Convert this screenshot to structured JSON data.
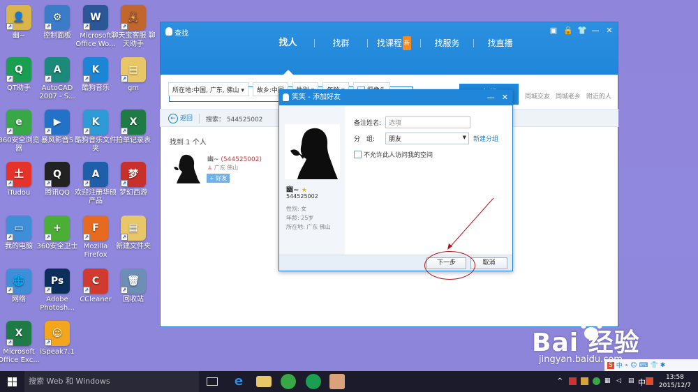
{
  "desktop": {
    "icons": [
      {
        "label": "幽~",
        "color": "#d9b54a",
        "glyph": "👤"
      },
      {
        "label": "控制面板",
        "color": "#3a7cc6",
        "glyph": "⚙"
      },
      {
        "label": "Microsoft Office Wo...",
        "color": "#2b5797",
        "glyph": "W"
      },
      {
        "label": "聊天宝客服 聊天助手",
        "color": "#c2662d",
        "glyph": "🧸"
      },
      {
        "label": "QT助手",
        "color": "#1a9e52",
        "glyph": "Q"
      },
      {
        "label": "AutoCAD 2007 - S...",
        "color": "#1b8a7a",
        "glyph": "A"
      },
      {
        "label": "酷狗音乐",
        "color": "#1b86d6",
        "glyph": "K"
      },
      {
        "label": "gm",
        "color": "#e8c768",
        "glyph": "▤"
      },
      {
        "label": "360安全浏览器",
        "color": "#37a845",
        "glyph": "e"
      },
      {
        "label": "暴风影音5",
        "color": "#2273c8",
        "glyph": "▶"
      },
      {
        "label": "酷狗音乐文件夹",
        "color": "#2e9ad6",
        "glyph": "K"
      },
      {
        "label": "拍单记录表",
        "color": "#1e7b45",
        "glyph": "X"
      },
      {
        "label": "iTudou",
        "color": "#e6332a",
        "glyph": "土"
      },
      {
        "label": "腾讯QQ",
        "color": "#222",
        "glyph": "Q"
      },
      {
        "label": "欢迎注册华硕产品",
        "color": "#1f5ea8",
        "glyph": "A"
      },
      {
        "label": "梦幻西游",
        "color": "#c9302c",
        "glyph": "梦"
      },
      {
        "label": "我的电脑",
        "color": "#3f8ed8",
        "glyph": "▭"
      },
      {
        "label": "360安全卫士",
        "color": "#4caf35",
        "glyph": "+"
      },
      {
        "label": "Mozilla Firefox",
        "color": "#e66a1f",
        "glyph": "F"
      },
      {
        "label": "新建文件夹",
        "color": "#e8c768",
        "glyph": "▤"
      },
      {
        "label": "网络",
        "color": "#3f8ed8",
        "glyph": "🌐"
      },
      {
        "label": "Adobe Photosh...",
        "color": "#0b2e5a",
        "glyph": "Ps"
      },
      {
        "label": "CCleaner",
        "color": "#d13b2f",
        "glyph": "C"
      },
      {
        "label": "回收站",
        "color": "#6e8fb5",
        "glyph": "🗑"
      },
      {
        "label": "Microsoft Office Exc...",
        "color": "#1e7b45",
        "glyph": "X"
      },
      {
        "label": "iSpeak7.1",
        "color": "#f3a51c",
        "glyph": "☺"
      }
    ]
  },
  "window": {
    "title": "查找",
    "controls": [
      "▣",
      "🔒",
      "👕",
      "—",
      "✕"
    ],
    "tabs": [
      {
        "label": "找人",
        "active": true,
        "badge": ""
      },
      {
        "label": "找群",
        "active": false,
        "badge": ""
      },
      {
        "label": "找课程",
        "active": false,
        "badge": "新"
      },
      {
        "label": "找服务",
        "active": false,
        "badge": ""
      },
      {
        "label": "找直播",
        "active": false,
        "badge": ""
      }
    ],
    "search_value": "544525002",
    "online_label": "在 线",
    "find_button": "查找",
    "quick_links": [
      "同城交友",
      "同城老乡",
      "附近的人"
    ],
    "filters": [
      "所在地:中国, 广东, 佛山 ▾",
      "故乡:中国",
      "性别 ▾",
      "年龄 ▾",
      "摄像头"
    ],
    "back_label": "返回",
    "breadcrumb": "搜索： 544525002",
    "found_text": "找到 1 个人",
    "result": {
      "name": "幽~",
      "qq": "(544525002)",
      "location": "广东 佛山",
      "add_label": "+ 好友"
    }
  },
  "dialog": {
    "title": "笑笑 - 添加好友",
    "name": "幽~",
    "qq": "544525002",
    "gender": "性别: 女",
    "age": "年龄: 25岁",
    "location": "所在地: 广东 佛山",
    "remark_label": "备注姓名:",
    "remark_placeholder": "选填",
    "group_label": "分　组:",
    "group_value": "朋友",
    "new_group": "新建分组",
    "no_access_label": "不允许此人访问我的空间",
    "next_button": "下一步",
    "cancel_button": "取消"
  },
  "watermark": {
    "brand": "Bai  经验",
    "url": "jingyan.baidu.com"
  },
  "taskbar": {
    "search_placeholder": "搜索 Web 和 Windows",
    "ime": "中",
    "time": "13:58",
    "date": "2015/12/7"
  },
  "colors": {
    "accent": "#1f86d9",
    "annotation": "#b3141b"
  }
}
